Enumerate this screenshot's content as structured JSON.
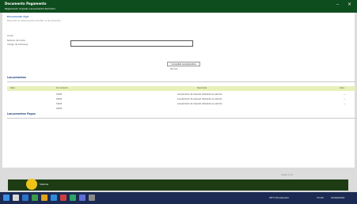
{
  "window": {
    "title": "Documento Pagamento",
    "subtitle": "Pagamento Imposto Lançamento Periódico"
  },
  "window_controls": [
    "–",
    "×"
  ],
  "page": {
    "breadcrumb": "Documento Ágil",
    "subtitle": "Preencha os campos para consultar os lançamentos"
  },
  "form": {
    "label_top": "Conta",
    "labels": [
      "Número da Conta",
      "Código de Cobrança"
    ],
    "field_value": "",
    "button_label": "Consultar Lançamentos",
    "hint": "Período"
  },
  "sections": {
    "first": "Lançamentos",
    "second": "Lançamentos Pagos"
  },
  "table": {
    "columns": [
      "Data",
      "Documento",
      "Descrição",
      "Valor"
    ],
    "rows": [
      {
        "date": "01/04",
        "doc": "",
        "desc": "Lançamento de imposto referente ao período",
        "value": "—"
      },
      {
        "date": "05/04",
        "doc": "",
        "desc": "Lançamento de imposto referente ao período",
        "value": "—"
      },
      {
        "date": "12/04",
        "doc": "",
        "desc": "Lançamento de imposto referente ao período",
        "value": "—"
      },
      {
        "date": "20/04",
        "doc": "",
        "desc": "",
        "value": ""
      }
    ]
  },
  "footer": {
    "brand": "Sistema",
    "version": "Versão 1.0.0"
  },
  "taskbar": {
    "weather": "28°C Ensolarado",
    "time": "15:04",
    "date": "22/04/2024"
  },
  "colors": {
    "title_bar": "#0e4d1e",
    "table_header": "#e8f0b8",
    "footer_bar": "#1d3c14",
    "logo": "#f0c419",
    "taskbar": "#1b2a52"
  }
}
